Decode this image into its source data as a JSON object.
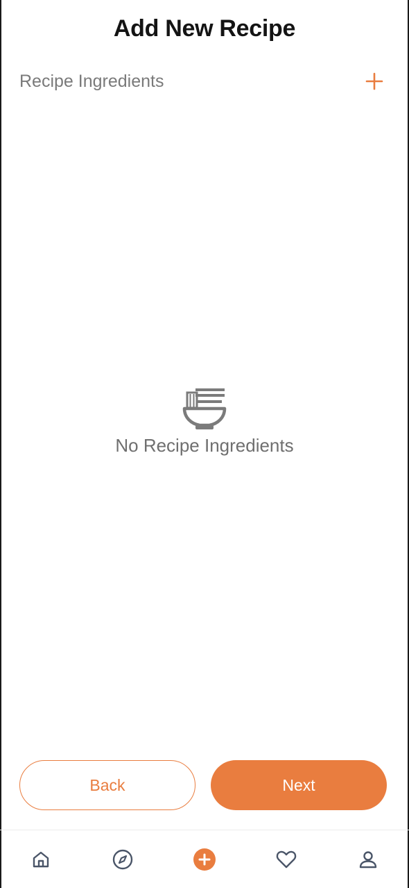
{
  "header": {
    "title": "Add New Recipe"
  },
  "ingredients_section": {
    "label": "Recipe Ingredients",
    "add_icon": "plus-icon"
  },
  "empty_state": {
    "icon": "noodle-bowl-icon",
    "message": "No Recipe Ingredients"
  },
  "actions": {
    "back_label": "Back",
    "next_label": "Next"
  },
  "bottom_nav": {
    "items": [
      {
        "icon": "home-icon",
        "active": false
      },
      {
        "icon": "compass-icon",
        "active": false
      },
      {
        "icon": "add-circle-icon",
        "active": true
      },
      {
        "icon": "heart-icon",
        "active": false
      },
      {
        "icon": "user-icon",
        "active": false
      }
    ]
  },
  "colors": {
    "accent": "#e97d3f",
    "muted_text": "#7a7a7a",
    "icon_gray": "#7b7b7b",
    "nav_icon": "#4a5568"
  }
}
